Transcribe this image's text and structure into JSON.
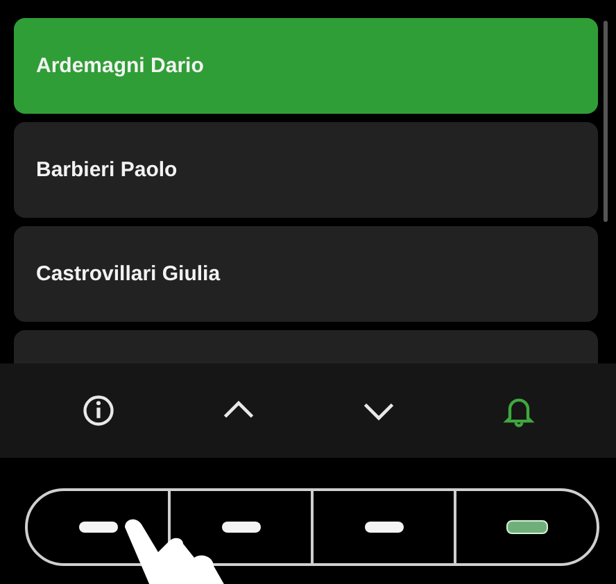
{
  "list": {
    "items": [
      {
        "name": "Ardemagni Dario",
        "selected": true
      },
      {
        "name": "Barbieri Paolo",
        "selected": false
      },
      {
        "name": "Castrovillari Giulia",
        "selected": false
      }
    ],
    "covered_items": [
      {
        "selected": false
      }
    ]
  },
  "toolbar": [
    {
      "kind": "info",
      "active": false
    },
    {
      "kind": "up",
      "active": false
    },
    {
      "kind": "down",
      "active": false
    },
    {
      "kind": "bell",
      "active": true
    }
  ],
  "hardware_keys": [
    {
      "lit": false
    },
    {
      "lit": false
    },
    {
      "lit": false
    },
    {
      "lit": true
    }
  ]
}
